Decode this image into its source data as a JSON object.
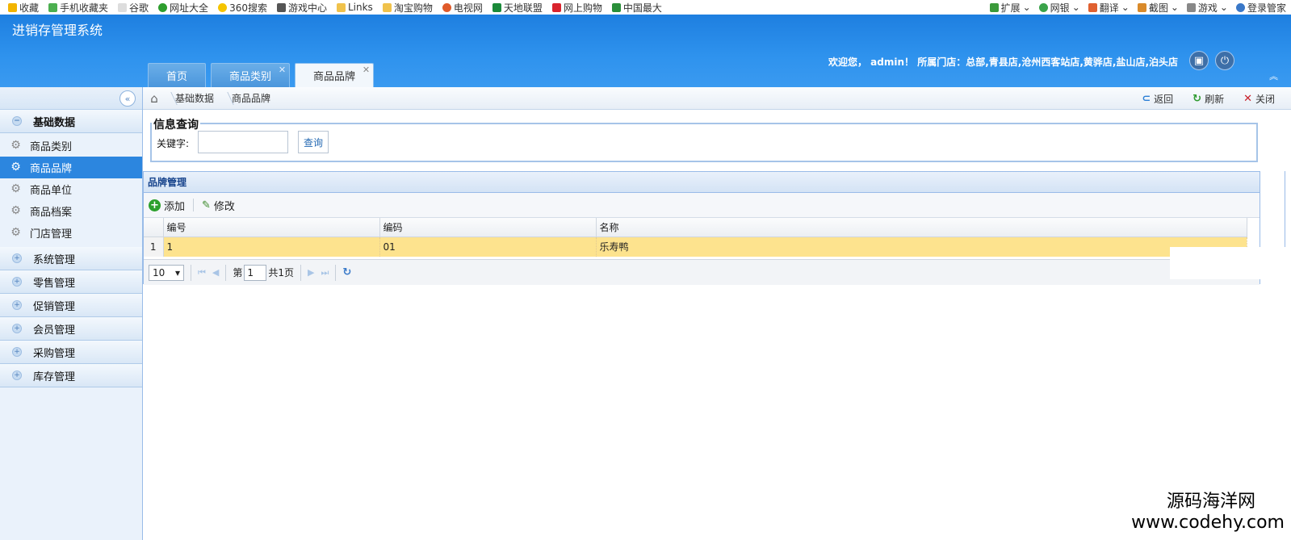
{
  "bookmarks": {
    "left": [
      "收藏",
      "手机收藏夹",
      "谷歌",
      "网址大全",
      "360搜索",
      "游戏中心",
      "Links",
      "淘宝购物",
      "电视网",
      "天地联盟",
      "网上购物",
      "中国最大"
    ],
    "right": [
      "扩展",
      "网银",
      "翻译",
      "截图",
      "游戏",
      "登录管家"
    ]
  },
  "header": {
    "app_title": "进销存管理系统",
    "welcome": "欢迎您， admin！ 所属门店：总部,青县店,沧州西客站店,黄骅店,盐山店,泊头店",
    "tabs": [
      {
        "label": "首页",
        "closable": false,
        "active": false
      },
      {
        "label": "商品类别",
        "closable": true,
        "active": false
      },
      {
        "label": "商品品牌",
        "closable": true,
        "active": true
      }
    ]
  },
  "sidebar": {
    "open_group": "基础数据",
    "items": [
      {
        "label": "商品类别",
        "active": false
      },
      {
        "label": "商品品牌",
        "active": true
      },
      {
        "label": "商品单位",
        "active": false
      },
      {
        "label": "商品档案",
        "active": false
      },
      {
        "label": "门店管理",
        "active": false
      }
    ],
    "groups": [
      "系统管理",
      "零售管理",
      "促销管理",
      "会员管理",
      "采购管理",
      "库存管理"
    ]
  },
  "breadcrumb": {
    "items": [
      "基础数据",
      "商品品牌"
    ],
    "actions": {
      "back": "返回",
      "refresh": "刷新",
      "close": "关闭"
    }
  },
  "query": {
    "legend": "信息查询",
    "keyword_label": "关键字:",
    "keyword_value": "",
    "button": "查询"
  },
  "grid": {
    "title": "品牌管理",
    "toolbar": {
      "add": "添加",
      "edit": "修改"
    },
    "columns": [
      "编号",
      "编码",
      "名称"
    ],
    "rows": [
      {
        "rn": "1",
        "id": "1",
        "code": "01",
        "name": "乐寿鸭"
      }
    ],
    "pager": {
      "page_size": "10",
      "page_prefix": "第",
      "page_value": "1",
      "total_text": "共1页"
    }
  },
  "watermark": {
    "line1": "源码海洋网",
    "line2": "www.codehy.com"
  },
  "colors": {
    "header_blue": "#2f93ee",
    "active_item": "#2c86df",
    "selected_row": "#fde38e"
  }
}
